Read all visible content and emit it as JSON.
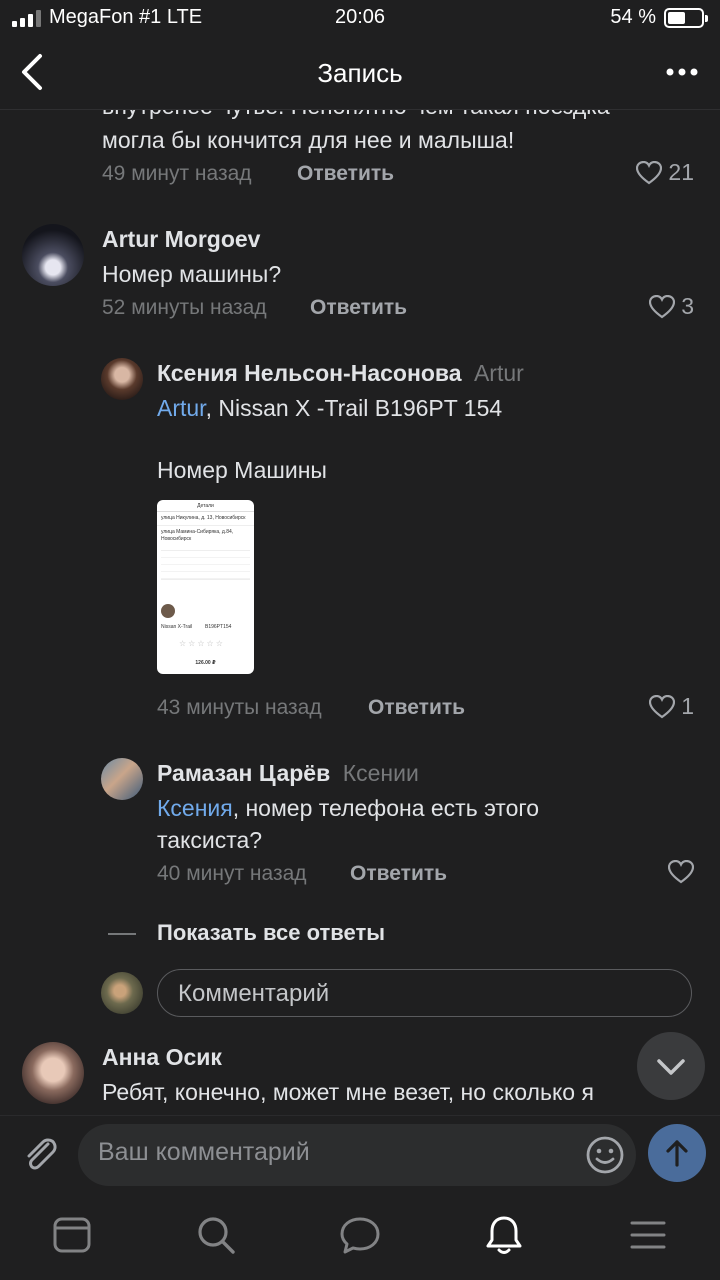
{
  "status": {
    "carrier": "MegaFon #1 LTE",
    "time": "20:06",
    "battery": "54 %",
    "battery_level": 0.54
  },
  "nav": {
    "title": "Запись"
  },
  "comments": {
    "c0": {
      "text_line1": "внутренее чутье. Непонятно чем такая поездка",
      "text_line2": "могла бы кончится для нее и малыша!",
      "time": "49 минут назад",
      "reply": "Ответить",
      "likes": "21"
    },
    "c1": {
      "author": "Artur Morgoev",
      "text": "Номер машины?",
      "time": "52 минуты назад",
      "reply": "Ответить",
      "likes": "3"
    },
    "c2": {
      "author": "Ксения Нельсон-Насонова",
      "to": "Artur",
      "mention": "Artur",
      "text_rest": ", Nissan X -Trail B196PT 154",
      "text2": "Номер Машины",
      "time": "43 минуты назад",
      "reply": "Ответить",
      "likes": "1",
      "thumb": {
        "header": "Детали",
        "addr1": "улица Никулина, д. 13, Новосибирск",
        "addr2": "улица Мамина-Сибиряка, д.84, Новосибирск",
        "car": "Nissan X-Trail",
        "plate": "B196PT154",
        "price": "126.00 ₽"
      }
    },
    "c3": {
      "author": "Рамазан Царёв",
      "to": "Ксении",
      "mention": "Ксения",
      "text_rest": ", номер телефона есть этого",
      "text_line2": "таксиста?",
      "time": "40 минут назад",
      "reply": "Ответить"
    },
    "show_all": "Показать все ответы",
    "comment_placeholder": "Комментарий",
    "c4": {
      "author": "Анна Осик",
      "text": "Ребят, конечно, может мне везет, но сколько я"
    }
  },
  "input": {
    "placeholder": "Ваш комментарий"
  },
  "tabs": [
    "news",
    "search",
    "messages",
    "notifications",
    "menu"
  ]
}
